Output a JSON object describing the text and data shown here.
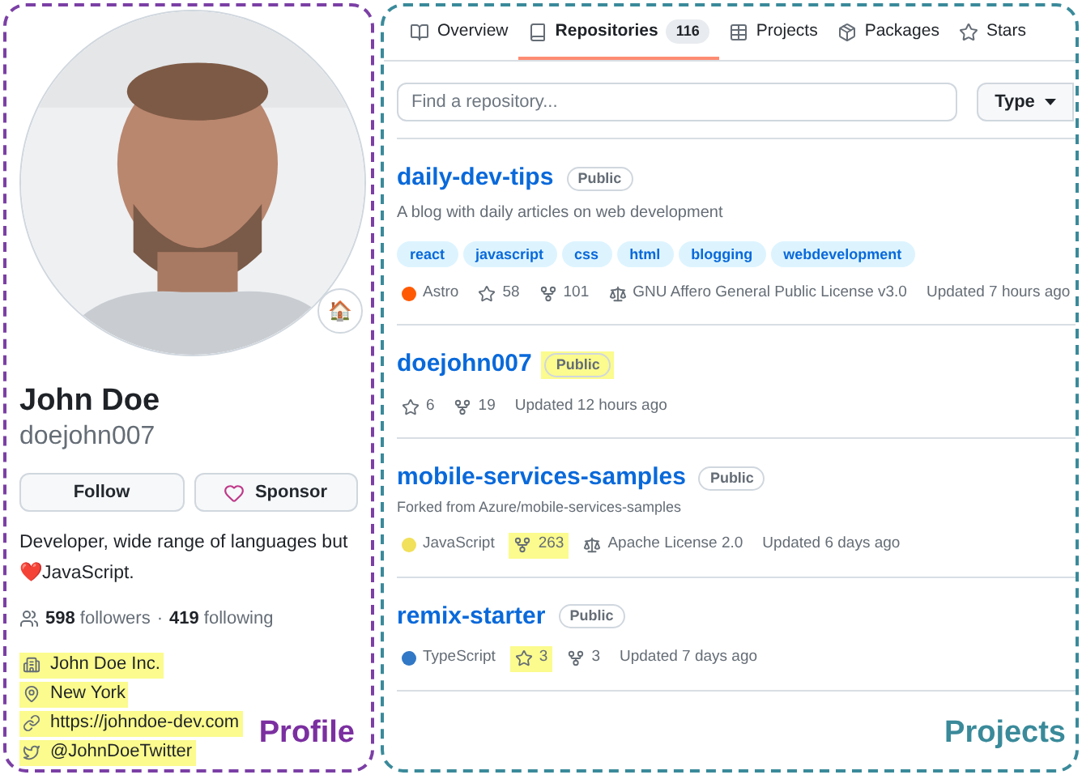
{
  "profile": {
    "name": "John Doe",
    "username": "doejohn007",
    "avatar": {
      "kind": "picture",
      "status_emoji": "🏠"
    },
    "buttons": [
      {
        "label": "Follow",
        "kind": "plain"
      },
      {
        "label": "Sponsor",
        "kind": "sponsor"
      }
    ],
    "bio": "Developer, wide range of languages but ❤️JavaScript.",
    "followers": {
      "count": "598",
      "label": "followers",
      "separator": "·",
      "following_count": "419",
      "following_label": "following"
    },
    "details": [
      {
        "kind": "organization",
        "text": "John Doe Inc.",
        "highlighted": true
      },
      {
        "kind": "location",
        "text": "New York",
        "highlighted": true
      },
      {
        "kind": "link",
        "text": "https://johndoe-dev.com",
        "highlighted": true
      },
      {
        "kind": "twitter",
        "text": "@JohnDoeTwitter",
        "highlighted": true
      }
    ],
    "label": "Profile"
  },
  "repositories": {
    "tabs": [
      {
        "label": "Overview",
        "kind": "book",
        "selected": false
      },
      {
        "label": "Repositories",
        "kind": "repo",
        "count": "116",
        "selected": true
      },
      {
        "label": "Projects",
        "kind": "table",
        "selected": false
      },
      {
        "label": "Packages",
        "kind": "package",
        "selected": false
      },
      {
        "label": "Stars",
        "kind": "star",
        "selected": false
      }
    ],
    "search": {
      "placeholder": "Find a repository..."
    },
    "type_button": "Type",
    "items": [
      {
        "name": "daily-dev-tips",
        "visibility": "Public",
        "visibility_highlighted": false,
        "description": "A blog with daily articles on web development",
        "topics": [
          "react",
          "javascript",
          "css",
          "html",
          "blogging",
          "webdevelopment"
        ],
        "meta": [
          {
            "kind": "language",
            "text": "Astro",
            "color": "#ff5a03",
            "highlighted": false
          },
          {
            "kind": "stars",
            "text": "58",
            "highlighted": false
          },
          {
            "kind": "forks",
            "text": "101",
            "highlighted": false
          },
          {
            "kind": "license",
            "text": "GNU Affero General Public License v3.0",
            "highlighted": false
          },
          {
            "kind": "updated",
            "text": "Updated 7 hours ago",
            "highlighted": false
          }
        ]
      },
      {
        "name": "doejohn007",
        "visibility": "Public",
        "visibility_highlighted": true,
        "meta": [
          {
            "kind": "stars",
            "text": "6",
            "highlighted": false
          },
          {
            "kind": "forks",
            "text": "19",
            "highlighted": false
          },
          {
            "kind": "updated",
            "text": "Updated 12 hours ago",
            "highlighted": false
          }
        ]
      },
      {
        "name": "mobile-services-samples",
        "visibility": "Public",
        "visibility_highlighted": false,
        "fork_note": "Forked from Azure/mobile-services-samples",
        "meta": [
          {
            "kind": "language",
            "text": "JavaScript",
            "color": "#f1e05a",
            "highlighted": false
          },
          {
            "kind": "forks",
            "text": "263",
            "highlighted": true
          },
          {
            "kind": "license",
            "text": "Apache License 2.0",
            "highlighted": false
          },
          {
            "kind": "updated",
            "text": "Updated 6 days ago",
            "highlighted": false
          }
        ]
      },
      {
        "name": "remix-starter",
        "visibility": "Public",
        "visibility_highlighted": false,
        "meta": [
          {
            "kind": "language",
            "text": "TypeScript",
            "color": "#3178c6",
            "highlighted": false
          },
          {
            "kind": "stars",
            "text": "3",
            "highlighted": true
          },
          {
            "kind": "forks",
            "text": "3",
            "highlighted": false
          },
          {
            "kind": "updated",
            "text": "Updated 7 days ago",
            "highlighted": false
          }
        ]
      }
    ],
    "label": "Projects"
  }
}
